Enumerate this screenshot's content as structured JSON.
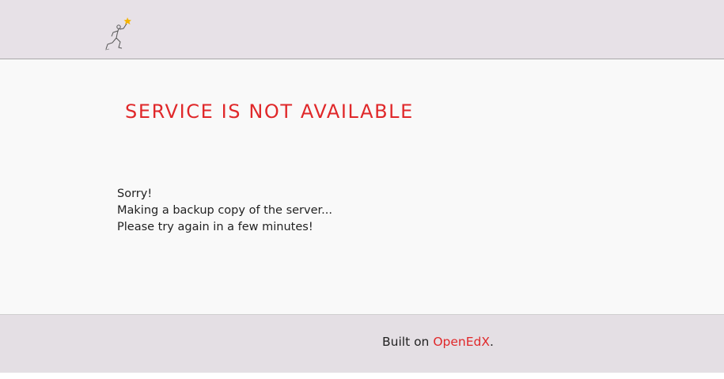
{
  "header": {
    "logo_icon": "runner-with-torch-icon",
    "accent_color": "#f5b300"
  },
  "main": {
    "title": "SERVICE IS NOT AVAILABLE",
    "title_color": "#e0282a",
    "message_lines": [
      "Sorry!",
      "Making a backup copy of the server...",
      "Please try again in a few minutes!"
    ]
  },
  "footer": {
    "prefix": "Built on ",
    "link_text": "OpenEdX",
    "suffix": ".",
    "link_color": "#e0282a"
  }
}
